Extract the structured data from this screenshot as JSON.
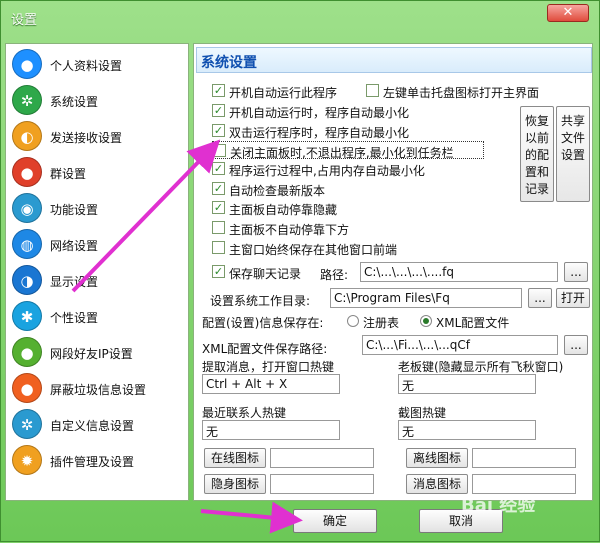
{
  "window": {
    "title": "设置",
    "close_label": "✕"
  },
  "sidebar": {
    "items": [
      {
        "label": "个人资料设置",
        "color": "#1e90ff",
        "glyph": "●"
      },
      {
        "label": "系统设置",
        "color": "#2ea84a",
        "glyph": "✲"
      },
      {
        "label": "发送接收设置",
        "color": "#f0a020",
        "glyph": "◐"
      },
      {
        "label": "群设置",
        "color": "#e0402a",
        "glyph": "●"
      },
      {
        "label": "功能设置",
        "color": "#2a9ad0",
        "glyph": "◉"
      },
      {
        "label": "网络设置",
        "color": "#1e88e5",
        "glyph": "◍"
      },
      {
        "label": "显示设置",
        "color": "#1a76d2",
        "glyph": "◑"
      },
      {
        "label": "个性设置",
        "color": "#1aa3e0",
        "glyph": "✱"
      },
      {
        "label": "网段好友IP设置",
        "color": "#55b030",
        "glyph": "●"
      },
      {
        "label": "屏蔽垃圾信息设置",
        "color": "#f06020",
        "glyph": "●"
      },
      {
        "label": "自定义信息设置",
        "color": "#2a9ad0",
        "glyph": "✲"
      },
      {
        "label": "插件管理及设置",
        "color": "#f0a020",
        "glyph": "✹"
      }
    ]
  },
  "main": {
    "section_title": "系统设置",
    "options": [
      {
        "label": "开机自动运行此程序",
        "checked": true
      },
      {
        "label": "左键单击托盘图标打开主界面",
        "checked": false
      },
      {
        "label": "开机自动运行时，程序自动最小化",
        "checked": true
      },
      {
        "label": "双击运行程序时，程序自动最小化",
        "checked": true
      },
      {
        "label": "关闭主面板时,不退出程序,最小化到任务栏",
        "checked": false
      },
      {
        "label": "程序运行过程中,占用内存自动最小化",
        "checked": true
      },
      {
        "label": "自动检查最新版本",
        "checked": true
      },
      {
        "label": "主面板自动停靠隐藏",
        "checked": true
      },
      {
        "label": "主面板不自动停靠下方",
        "checked": false
      },
      {
        "label": "主窗口始终保存在其他窗口前端",
        "checked": false
      },
      {
        "label": "保存聊天记录",
        "checked": true
      }
    ],
    "restore_button": "恢复以前的配置和记录",
    "share_button": "共享文件设置",
    "path_label": "路径:",
    "path_value": "C:\\...\\...\\...\\....fq",
    "browse_label": "...",
    "workdir_label": "设置系统工作目录:",
    "workdir_value": "C:\\Program Files\\Fq",
    "open_label": "打开",
    "config_label": "配置(设置)信息保存在:",
    "radio_registry": "注册表",
    "radio_xml": "XML配置文件",
    "xml_path_label": "XML配置文件保存路径:",
    "xml_path_value": "C:\\...\\Fi...\\...\\...qCf",
    "hotkey_label": "提取消息，打开窗口热键",
    "hotkey_value": "Ctrl + Alt + X",
    "boss_key_label": "老板键(隐藏显示所有飞秋窗口)",
    "boss_key_value": "无",
    "recent_hotkey_label": "最近联系人热键",
    "recent_hotkey_value": "无",
    "screenshot_hotkey_label": "截图热键",
    "screenshot_hotkey_value": "无",
    "online_icon_label": "在线图标",
    "offline_icon_label": "离线图标",
    "hidden_icon_label": "隐身图标",
    "message_icon_label": "消息图标"
  },
  "footer": {
    "ok_label": "确定",
    "cancel_label": "取消"
  },
  "watermark": "Bai 经验",
  "colors": {
    "window_green": "#7fd06a",
    "section_blue": "#1050b0",
    "arrow_magenta": "#e030d0"
  }
}
